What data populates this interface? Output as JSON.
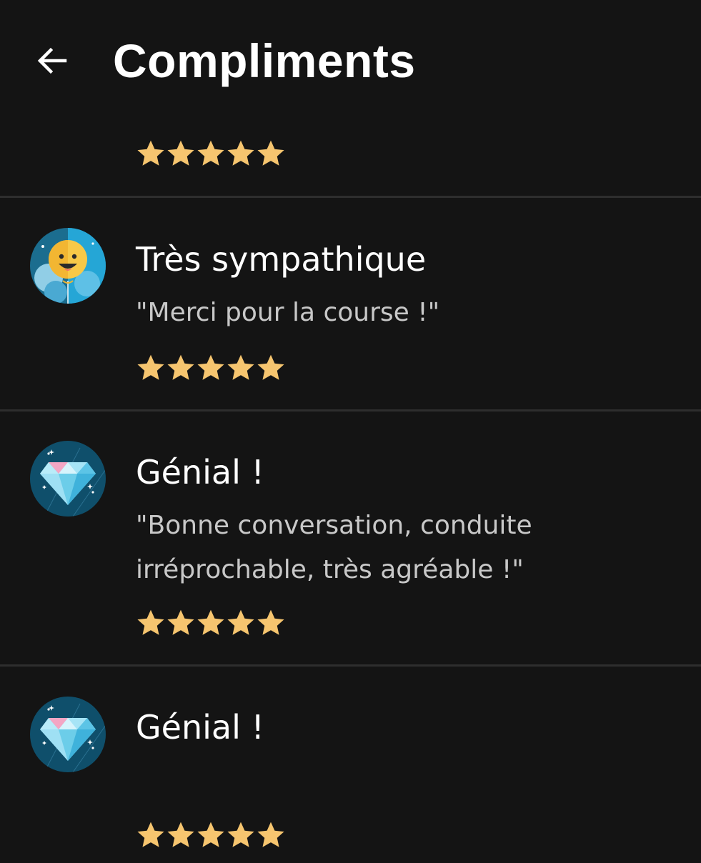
{
  "header": {
    "title": "Compliments",
    "back_icon": "arrow-left-icon"
  },
  "colors": {
    "background": "#141414",
    "divider": "#2e2e2e",
    "star": "#f6c56f",
    "title_text": "#ffffff",
    "quote_text": "#c8c8c8"
  },
  "top_rating": {
    "stars": 5
  },
  "compliments": [
    {
      "title": "Très sympathique",
      "quote": "\"Merci pour la course !\"",
      "stars": 5,
      "badge_icon": "smiley-balloon-icon"
    },
    {
      "title": "Génial !",
      "quote": "\"Bonne conversation, conduite irréprochable, très agréable !\"",
      "stars": 5,
      "badge_icon": "diamond-icon"
    },
    {
      "title": "Génial !",
      "quote": "",
      "stars": 5,
      "badge_icon": "diamond-icon"
    }
  ]
}
